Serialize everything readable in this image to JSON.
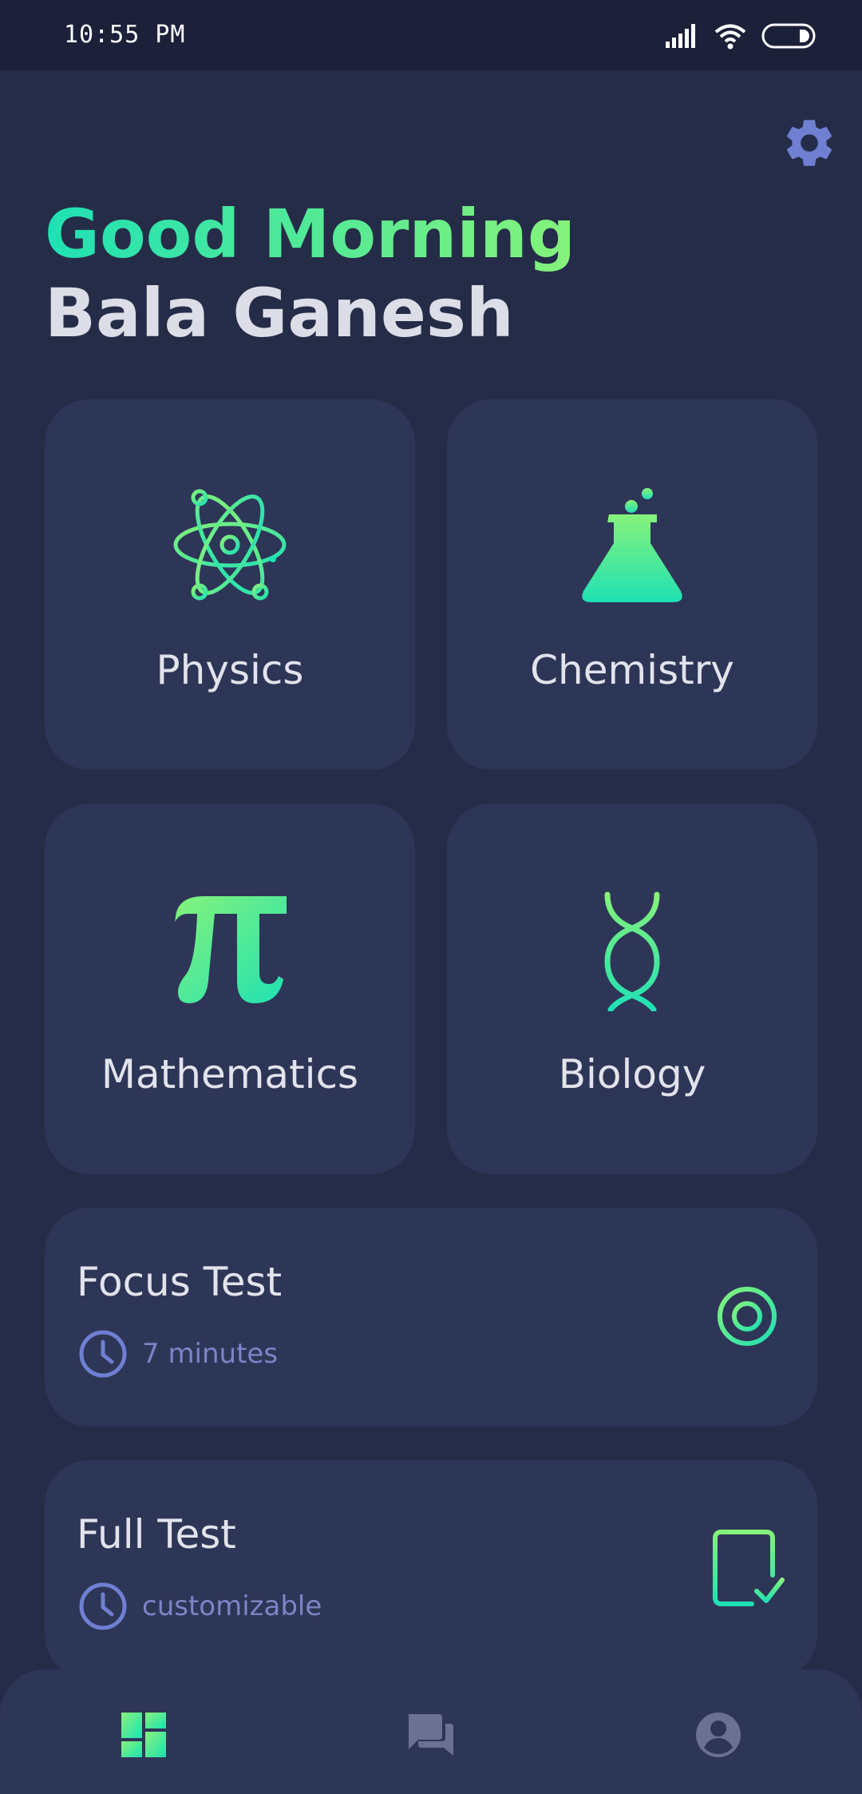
{
  "status_bar": {
    "time": "10:55 PM"
  },
  "header": {
    "greeting": "Good Morning",
    "user_name": "Bala Ganesh"
  },
  "subjects": [
    {
      "label": "Physics",
      "icon": "atom-icon"
    },
    {
      "label": "Chemistry",
      "icon": "flask-icon"
    },
    {
      "label": "Mathematics",
      "icon": "pi-icon"
    },
    {
      "label": "Biology",
      "icon": "dna-icon"
    }
  ],
  "tests": [
    {
      "title": "Focus Test",
      "meta": "7 minutes",
      "icon": "target-icon"
    },
    {
      "title": "Full Test",
      "meta": "customizable",
      "icon": "checklist-icon"
    }
  ],
  "bottom_nav": [
    {
      "name": "dashboard",
      "icon": "dashboard-icon",
      "active": true
    },
    {
      "name": "forum",
      "icon": "chat-icon",
      "active": false
    },
    {
      "name": "profile",
      "icon": "account-icon",
      "active": false
    }
  ],
  "colors": {
    "background": "#252c48",
    "card": "#2e3657",
    "accent_start": "#1fe1b4",
    "accent_end": "#86f27a",
    "muted_blue": "#7b85c6"
  }
}
